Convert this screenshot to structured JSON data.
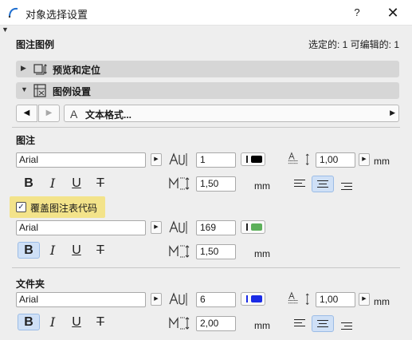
{
  "window": {
    "title": "对象选择设置",
    "help_label": "?",
    "close_label": "✕"
  },
  "header": {
    "section_title": "图注图例",
    "selection_info": "选定的: 1 可编辑的: 1"
  },
  "groups": {
    "preview": {
      "label": "预览和定位",
      "expanded": false
    },
    "legend": {
      "label": "图例设置",
      "expanded": true
    }
  },
  "nav": {
    "prev_icon": "◀",
    "next_icon": "▶",
    "page_label": "文本格式..."
  },
  "label_section": {
    "title": "图注",
    "font": "Arial",
    "pen": "1",
    "pen_color": "#000000",
    "line_spacing": "1,00",
    "line_spacing_unit": "mm",
    "size": "1,50",
    "size_unit": "mm",
    "bold_active": false,
    "alignment_active": "center"
  },
  "override": {
    "checked": true,
    "label": "覆盖图注表代码"
  },
  "override_section": {
    "font": "Arial",
    "pen": "169",
    "pen_color": "#5cb05a",
    "size": "1,50",
    "size_unit": "mm",
    "bold_active": true
  },
  "folder_section": {
    "title": "文件夹",
    "font": "Arial",
    "pen": "6",
    "pen_color": "#1a2be6",
    "line_spacing": "1,00",
    "line_spacing_unit": "mm",
    "size": "2,00",
    "size_unit": "mm",
    "bold_active": true,
    "alignment_active": "center"
  },
  "style_labels": {
    "bold": "B",
    "italic": "I",
    "underline": "U",
    "strike": "T"
  },
  "icons": {
    "app": "arc-tool-icon",
    "preview": "preview-position-icon",
    "legend": "legend-settings-icon",
    "font": "text-font-icon",
    "pen": "letter-spacing-icon",
    "size": "text-size-icon",
    "line_spacing": "line-spacing-icon"
  }
}
